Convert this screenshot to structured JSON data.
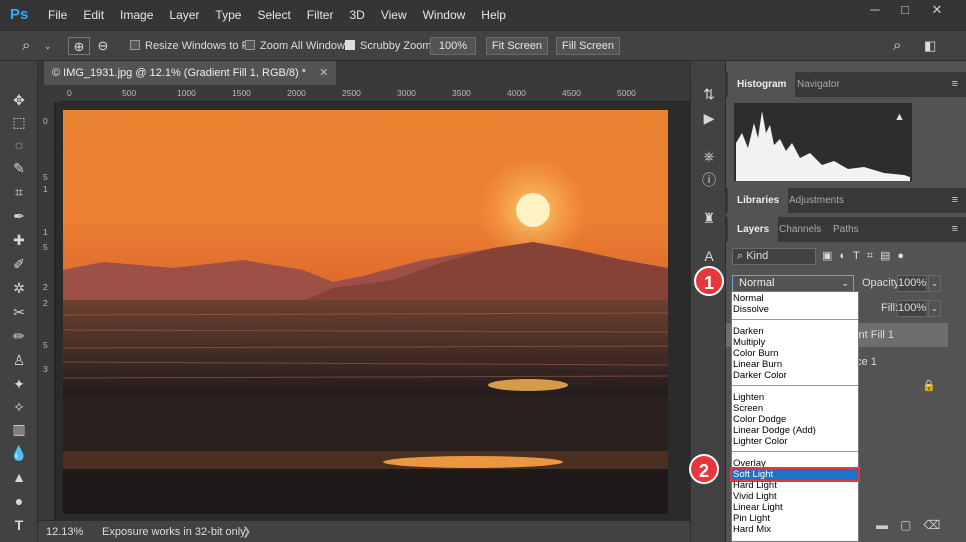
{
  "app": {
    "logo": "Ps"
  },
  "menu": [
    "File",
    "Edit",
    "Image",
    "Layer",
    "Type",
    "Select",
    "Filter",
    "3D",
    "View",
    "Window",
    "Help"
  ],
  "window_controls": {
    "minimize": "─",
    "restore": "□",
    "close": "✕"
  },
  "options": {
    "resize_windows": "Resize Windows to Fit",
    "zoom_all": "Zoom All Windows",
    "scrubby": "Scrubby Zoom",
    "zoom_value": "100%",
    "fit_screen": "Fit Screen",
    "fill_screen": "Fill Screen"
  },
  "document": {
    "tab_title": "© IMG_1931.jpg @ 12.1% (Gradient Fill 1, RGB/8) *",
    "close": "✕"
  },
  "ruler_top": [
    "0",
    "500",
    "1000",
    "1500",
    "2000",
    "2500",
    "3000",
    "3500",
    "4000",
    "4500",
    "5000"
  ],
  "ruler_left": [
    "0",
    "5",
    "1",
    "1",
    "5",
    "2",
    "2",
    "5",
    "3"
  ],
  "status": {
    "zoom": "12.13%",
    "message": "Exposure works in 32-bit only",
    "arrow": "❯"
  },
  "panels": {
    "top_tabs": [
      "Histogram",
      "Navigator"
    ],
    "warning": "▲",
    "mid_tabs": [
      "Libraries",
      "Adjustments"
    ],
    "layer_tabs": [
      "Layers",
      "Channels",
      "Paths"
    ],
    "filter_kind": "Kind",
    "blend_mode": "Normal",
    "opacity_label": "Opacity:",
    "opacity_value": "100%",
    "fill_label": "Fill:",
    "fill_value": "100%",
    "layer1": "ient Fill 1",
    "layer2": "nce 1"
  },
  "blend_groups": [
    [
      "Normal",
      "Dissolve"
    ],
    [
      "Darken",
      "Multiply",
      "Color Burn",
      "Linear Burn",
      "Darker Color"
    ],
    [
      "Lighten",
      "Screen",
      "Color Dodge",
      "Linear Dodge (Add)",
      "Lighter Color"
    ],
    [
      "Overlay",
      "Soft Light",
      "Hard Light",
      "Vivid Light",
      "Linear Light",
      "Pin Light",
      "Hard Mix"
    ]
  ],
  "selected_blend": "Soft Light",
  "callouts": [
    "1",
    "2"
  ],
  "colors": {
    "accent": "#31a8ff",
    "highlight": "#1f72c7",
    "callout": "#e8373a"
  }
}
